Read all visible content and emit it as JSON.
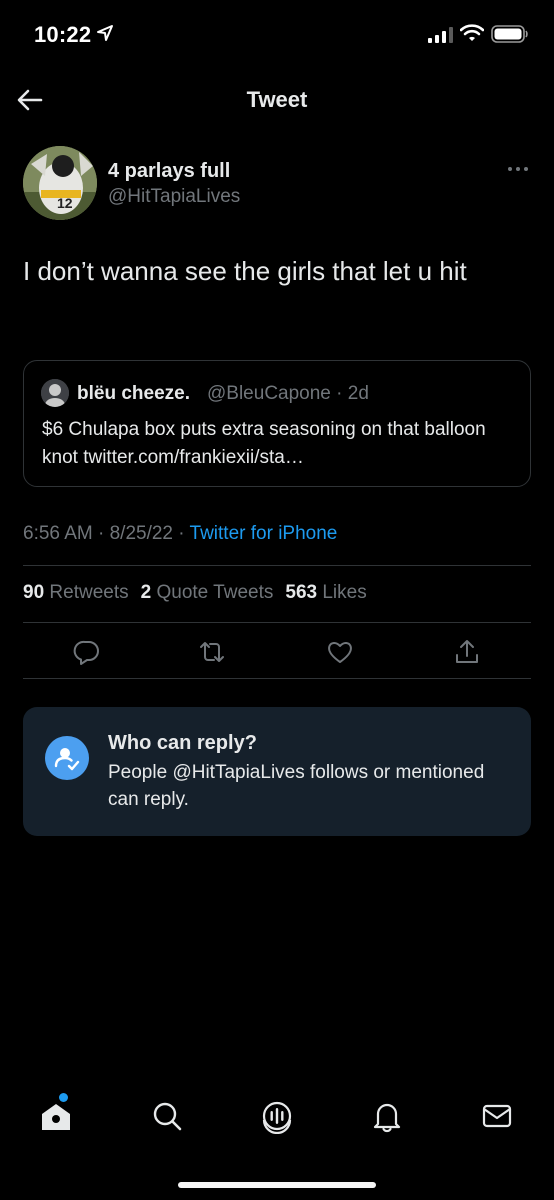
{
  "status_bar": {
    "time": "10:22"
  },
  "nav": {
    "title": "Tweet"
  },
  "tweet": {
    "author_name": "4 parlays full",
    "author_handle": "@HitTapiaLives",
    "text": "I don’t wanna see the girls that let u hit",
    "quote": {
      "author_name": "blëu cheeze.",
      "author_handle": "@BleuCapone · 2d",
      "text": "$6 Chulapa box puts extra seasoning on that balloon knot twitter.com/frankiexii/sta…"
    },
    "time": "6:56 AM · 8/25/22 · ",
    "source": "Twitter for iPhone",
    "stats": {
      "retweets_count": "90",
      "retweets_label": "Retweets",
      "quotes_count": "2",
      "quotes_label": "Quote Tweets",
      "likes_count": "563",
      "likes_label": "Likes"
    }
  },
  "who_can_reply": {
    "title": "Who can reply?",
    "description": "People @HitTapiaLives follows or mentioned can reply."
  },
  "icons": {
    "back": "arrow-left-icon",
    "more": "more-icon",
    "reply": "reply-icon",
    "retweet": "retweet-icon",
    "like": "heart-icon",
    "share": "share-icon",
    "tabs": [
      "home-icon",
      "search-icon",
      "spaces-icon",
      "notifications-icon",
      "messages-icon"
    ]
  },
  "colors": {
    "background": "#000000",
    "accent": "#1d9bf0",
    "secondary_text": "#71767b",
    "divider": "#2f3336",
    "card": "#15202b"
  }
}
